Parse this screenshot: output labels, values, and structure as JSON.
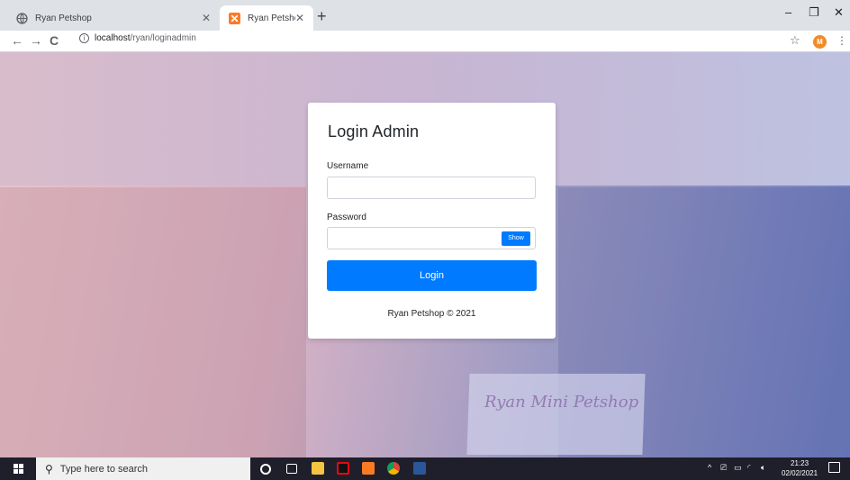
{
  "browser": {
    "tabs": [
      {
        "title": "Ryan Petshop",
        "active": false,
        "favicon": "globe-icon"
      },
      {
        "title": "Ryan Petshop",
        "active": true,
        "favicon": "xampp-icon"
      }
    ],
    "address": {
      "host": "localhost",
      "path": "/ryan/loginadmin"
    },
    "profile_initial": "M",
    "accent_color": "#f28b26"
  },
  "page": {
    "background_sign_text": "Ryan Mini Petshop"
  },
  "login": {
    "title": "Login Admin",
    "username_label": "Username",
    "username_value": "",
    "password_label": "Password",
    "password_value": "",
    "show_label": "Show",
    "submit_label": "Login",
    "footer": "Ryan Petshop © 2021",
    "primary_color": "#007bff"
  },
  "taskbar": {
    "search_placeholder": "Type here to search",
    "time": "21:23",
    "date": "02/02/2021",
    "pinned_apps": [
      "cortana-icon",
      "task-view-icon",
      "file-explorer-icon",
      "netflix-icon",
      "xampp-icon",
      "chrome-icon",
      "word-icon"
    ]
  }
}
